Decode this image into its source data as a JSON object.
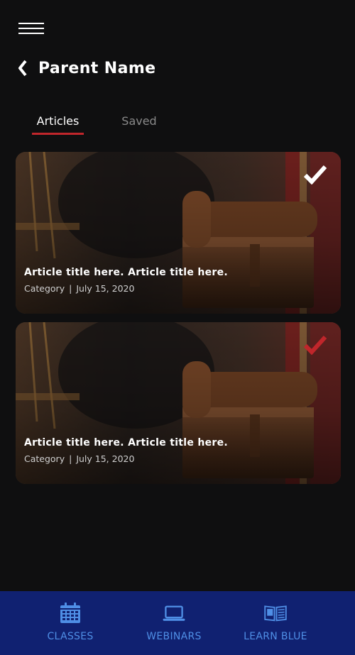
{
  "header": {
    "title": "Parent Name",
    "back_glyph": "❮"
  },
  "tabs": [
    {
      "label": "Articles",
      "active": true
    },
    {
      "label": "Saved",
      "active": false
    }
  ],
  "articles": [
    {
      "title": "Article title here. Article title here.",
      "category": "Category",
      "separator": "|",
      "date": "July 15, 2020",
      "saved": false,
      "check_color": "#ffffff"
    },
    {
      "title": "Article title here. Article title here.",
      "category": "Category",
      "separator": "|",
      "date": "July 15, 2020",
      "saved": true,
      "check_color": "#c0262b"
    }
  ],
  "bottom_nav": [
    {
      "label": "CLASSES",
      "icon": "calendar-icon"
    },
    {
      "label": "WEBINARS",
      "icon": "laptop-icon"
    },
    {
      "label": "LEARN BLUE",
      "icon": "open-book-icon"
    }
  ],
  "colors": {
    "accent": "#c0262b",
    "nav_bg": "#102171",
    "nav_text": "#4f8fe6",
    "background": "#0f0f10"
  }
}
